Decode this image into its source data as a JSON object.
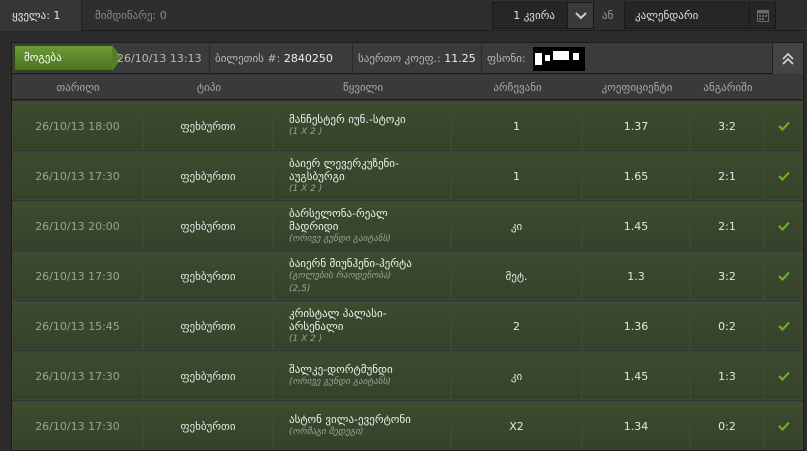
{
  "topbar": {
    "all_label": "ყველა: 1",
    "pending_label": "მიმდინარე: 0",
    "period_value": "1 კვირა",
    "or_label": "ან",
    "calendar_value": "კალენდარი"
  },
  "ticket": {
    "status": "მოგება",
    "datetime": "26/10/13 13:13",
    "number_label": "ბილეთის #:",
    "number_value": "2840250",
    "total_coef_label": "საერთო კოეფ.:",
    "total_coef_value": "11.25",
    "stake_label": "ფსონი:"
  },
  "columns": {
    "date": "თარიღი",
    "type": "ტიპი",
    "event": "წყვილი",
    "choice": "არჩევანი",
    "coef": "კოეფიციენტი",
    "score": "ანგარიში"
  },
  "rows": [
    {
      "date": "26/10/13 18:00",
      "type": "ფეხბურთი",
      "event": "მანჩესტერ იუნ.-სტოკი",
      "event2": "",
      "sub": "(1 X 2 )",
      "sub2": "",
      "choice": "1",
      "coef": "1.37",
      "score": "3:2"
    },
    {
      "date": "26/10/13 17:30",
      "type": "ფეხბურთი",
      "event": "ბაიერ ლევერკუზენი-",
      "event2": "აუგსბურგი",
      "sub": "(1 X 2 )",
      "sub2": "",
      "choice": "1",
      "coef": "1.65",
      "score": "2:1"
    },
    {
      "date": "26/10/13 20:00",
      "type": "ფეხბურთი",
      "event": "ბარსელონა-რეალ",
      "event2": "მადრიდი",
      "sub": "(ორივე გუნდი გაიტანს)",
      "sub2": "",
      "choice": "კი",
      "coef": "1.45",
      "score": "2:1"
    },
    {
      "date": "26/10/13 17:30",
      "type": "ფეხბურთი",
      "event": "ბაიერნ მიუნჰენი-ჰერტა",
      "event2": "",
      "sub": "(გოლების რაოდენობა)",
      "sub2": "(2,5)",
      "choice": "მეტ.",
      "coef": "1.3",
      "score": "3:2"
    },
    {
      "date": "26/10/13 15:45",
      "type": "ფეხბურთი",
      "event": "კრისტალ პალასი-",
      "event2": "არსენალი",
      "sub": "(1 X 2 )",
      "sub2": "",
      "choice": "2",
      "coef": "1.36",
      "score": "0:2"
    },
    {
      "date": "26/10/13 17:30",
      "type": "ფეხბურთი",
      "event": "შალკე-დორტმუნდი",
      "event2": "",
      "sub": "(ორივე გუნდი გაიტანს)",
      "sub2": "",
      "choice": "კი",
      "coef": "1.45",
      "score": "1:3"
    },
    {
      "date": "26/10/13 17:30",
      "type": "ფეხბურთი",
      "event": "ასტონ ვილა-ევერტონი",
      "event2": "",
      "sub": "(ორმაგი შედეგი)",
      "sub2": "",
      "choice": "X2",
      "coef": "1.34",
      "score": "0:2"
    }
  ],
  "colors": {
    "win_green": "#5a8a2c",
    "check_green": "#6cae2c",
    "row_green": "#3c4c2e"
  }
}
